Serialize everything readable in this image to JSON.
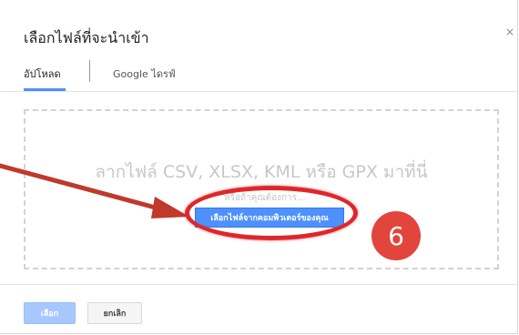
{
  "dialog": {
    "title": "เลือกไฟล์ที่จะนำเข้า",
    "close_label": "×"
  },
  "tabs": [
    {
      "label": "อัปโหลด",
      "active": true
    },
    {
      "label": "Google ไดรฟ์",
      "active": false
    }
  ],
  "dropzone": {
    "drag_text": "ลากไฟล์ CSV, XLSX, KML หรือ GPX มาที่นี่",
    "or_text": "หรือถ้าคุณต้องการ...",
    "choose_button_label": "เลือกไฟล์จากคอมพิวเตอร์ของคุณ"
  },
  "annotation": {
    "step_number": "6",
    "highlight_color": "#e0262b",
    "arrow_color": "#c0392b",
    "badge_color": "#e2453c"
  },
  "footer": {
    "select_label": "เลือก",
    "cancel_label": "ยกเลิก"
  },
  "colors": {
    "accent": "#4d90fe",
    "accent_disabled": "#a6c8ff"
  }
}
